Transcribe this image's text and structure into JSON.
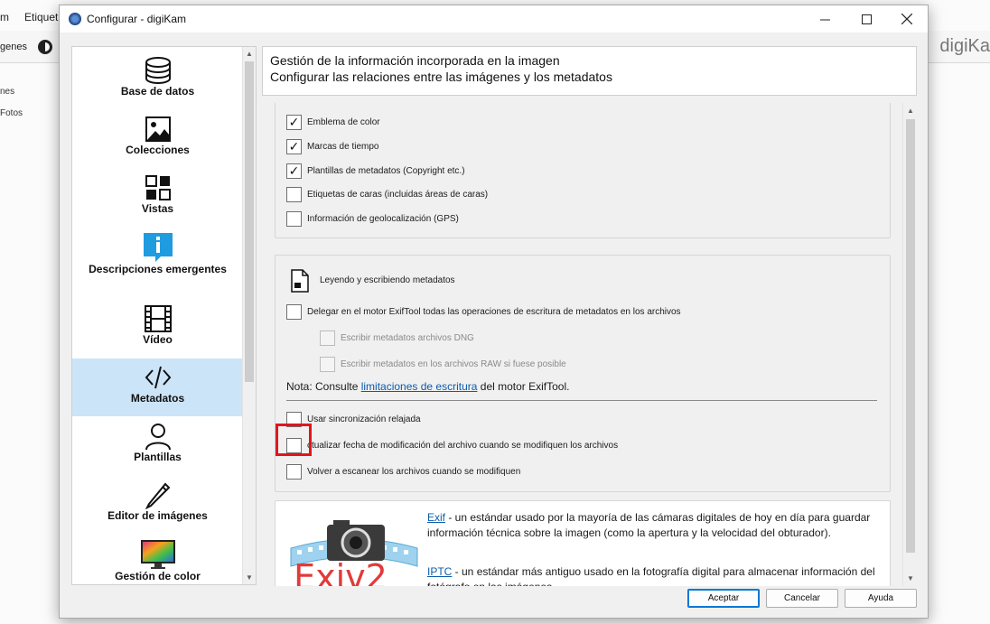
{
  "window": {
    "title": "Configurar - digiKam"
  },
  "background_app": {
    "menu": [
      "m",
      "Etiquet"
    ],
    "toolbar_text": "genes",
    "brand": "digiKa",
    "left_items": [
      "nes",
      "Fotos"
    ]
  },
  "sidebar": {
    "items": [
      {
        "label": "Base de datos",
        "icon": "database-icon"
      },
      {
        "label": "Colecciones",
        "icon": "image-icon"
      },
      {
        "label": "Vistas",
        "icon": "grid-icon"
      },
      {
        "label": "Descripciones emergentes",
        "icon": "info-icon"
      },
      {
        "label": "Vídeo",
        "icon": "film-icon"
      },
      {
        "label": "Metadatos",
        "icon": "code-icon",
        "selected": true
      },
      {
        "label": "Plantillas",
        "icon": "user-icon"
      },
      {
        "label": "Editor de imágenes",
        "icon": "pencil-icon"
      },
      {
        "label": "Gestión de color",
        "icon": "monitor-icon"
      }
    ]
  },
  "header": {
    "title": "Gestión de la información incorporada en la imagen",
    "subtitle": "Configurar las relaciones entre las imágenes y los metadatos"
  },
  "group1": {
    "options": [
      {
        "label": "Emblema de color",
        "checked": true
      },
      {
        "label": "Marcas de tiempo",
        "checked": true
      },
      {
        "label": "Plantillas de metadatos (Copyright etc.)",
        "checked": true
      },
      {
        "label": "Etiquetas de caras (incluidas áreas de caras)",
        "checked": false
      },
      {
        "label": "Información de geolocalización (GPS)",
        "checked": false
      }
    ]
  },
  "group2": {
    "title": "Leyendo y escribiendo metadatos",
    "exiftool": {
      "label": "Delegar en el motor ExifTool todas las operaciones de escritura de metadatos en los archivos",
      "checked": false
    },
    "dng": {
      "label": "Escribir metadatos archivos DNG",
      "checked": false
    },
    "raw": {
      "label": "Escribir metadatos en los archivos RAW si fuese posible",
      "checked": false
    },
    "note_prefix": "Nota: Consulte ",
    "note_link": "limitaciones de escritura",
    "note_suffix": " del motor ExifTool.",
    "lazy_sync": {
      "label": "Usar sincronización relajada",
      "checked": false
    },
    "update_date": {
      "label": "ctualizar fecha de modificación del archivo cuando se modifiquen los archivos",
      "checked": false
    },
    "rescan": {
      "label": "Volver a escanear los archivos cuando se modifiquen",
      "checked": false
    }
  },
  "info": {
    "logo_text": "Exiv2",
    "exif_link": "Exif",
    "exif_text": " - un estándar usado por la mayoría de las cámaras digitales de hoy en día para guardar información técnica sobre la imagen (como la apertura y la velocidad del obturador).",
    "iptc_link": "IPTC",
    "iptc_text": " - un estándar más antiguo usado en la fotografía digital para almacenar información del fotógrafo en las imágenes"
  },
  "buttons": {
    "ok": "Aceptar",
    "cancel": "Cancelar",
    "help": "Ayuda"
  },
  "colors": {
    "selection": "#cce4f7",
    "link": "#0b5cad",
    "highlight": "#e0161c",
    "default_button": "#0078d7"
  }
}
